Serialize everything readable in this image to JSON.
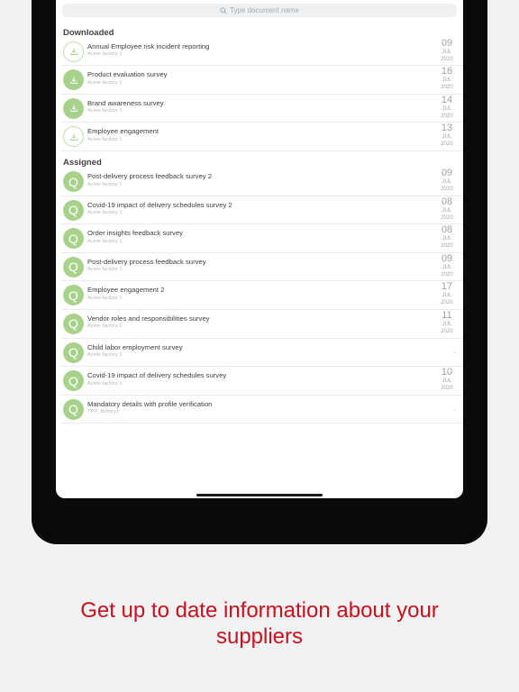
{
  "search": {
    "placeholder": "Type document name"
  },
  "downloaded": {
    "title": "Downloaded",
    "items": [
      {
        "name": "Annual Employee risk incident reporting",
        "sub": "Acme factory 1",
        "day": "09",
        "month": "JUL",
        "year": "2020",
        "status": "in-progress"
      },
      {
        "name": "Product evaluation survey",
        "sub": "Acme factory 1",
        "day": "16",
        "month": "JUL",
        "year": "2020",
        "status": "done"
      },
      {
        "name": "Brand awareness survey",
        "sub": "Acme factory 1",
        "day": "14",
        "month": "JUL",
        "year": "2020",
        "status": "done"
      },
      {
        "name": "Employee engagement",
        "sub": "Acme factory 1",
        "day": "13",
        "month": "JUL",
        "year": "2020",
        "status": "in-progress"
      }
    ]
  },
  "assigned": {
    "title": "Assigned",
    "avatar_letter": "Q",
    "no_date": "-",
    "items": [
      {
        "name": "Post-delivery process feedback survey 2",
        "sub": "Acme factory 1",
        "day": "09",
        "month": "JUL",
        "year": "2020"
      },
      {
        "name": "Covid-19 impact of delivery schedules survey 2",
        "sub": "Acme factory 1",
        "day": "08",
        "month": "JUL",
        "year": "2020"
      },
      {
        "name": "Order insights feedback survey",
        "sub": "Acme factory 1",
        "day": "08",
        "month": "JUL",
        "year": "2020"
      },
      {
        "name": "Post-delivery process feedback survey",
        "sub": "Acme factory 1",
        "day": "09",
        "month": "JUL",
        "year": "2020"
      },
      {
        "name": "Employee engagement 2",
        "sub": "Acme factory 1",
        "day": "17",
        "month": "JUL",
        "year": "2020"
      },
      {
        "name": "Vendor roles and responsibilities survey",
        "sub": "Acme factory 1",
        "day": "11",
        "month": "JUL",
        "year": "2020"
      },
      {
        "name": "Child labor employment survey",
        "sub": "Acme factory 1"
      },
      {
        "name": "Covid-19 impact of delivery schedules survey",
        "sub": "Acme factory 1",
        "day": "10",
        "month": "JUL",
        "year": "2020"
      },
      {
        "name": "Mandatory details with profile verification",
        "sub": "TPP_factory1"
      }
    ]
  },
  "tagline": {
    "line1": "Get up to date information about your",
    "line2": "suppliers"
  },
  "colors": {
    "accent_green": "#a8d28b",
    "tagline_red": "#c8111a"
  },
  "icons": {
    "search": "search-icon",
    "download": "download-icon"
  }
}
